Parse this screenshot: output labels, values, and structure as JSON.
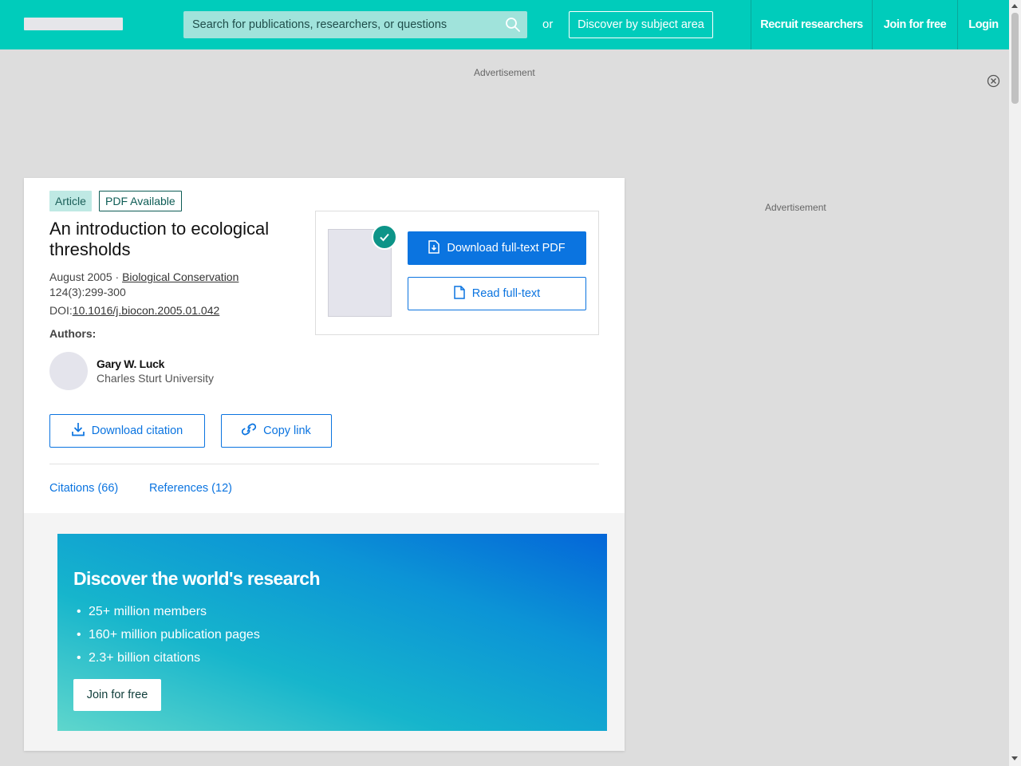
{
  "header": {
    "search_placeholder": "Search for publications, researchers, or questions",
    "or_text": "or",
    "discover_label": "Discover by subject area",
    "nav": {
      "recruit": "Recruit researchers",
      "join": "Join for free",
      "login": "Login"
    }
  },
  "ads": {
    "top_label": "Advertisement",
    "side_label": "Advertisement"
  },
  "article": {
    "badges": {
      "type": "Article",
      "pdf": "PDF Available"
    },
    "title": "An introduction to ecological thresholds",
    "date": "August 2005",
    "separator": " · ",
    "journal": "Biological Conservation",
    "volume_pages": "124(3):299-300",
    "doi_label": "DOI:",
    "doi": "10.1016/j.biocon.2005.01.042",
    "authors_label": "Authors:",
    "author": {
      "name": "Gary W. Luck",
      "institution": "Charles Sturt University"
    },
    "buttons": {
      "download_pdf": "Download full-text PDF",
      "read_fulltext": "Read full-text",
      "download_citation": "Download citation",
      "copy_link": "Copy link"
    },
    "tabs": {
      "citations": "Citations (66)",
      "references": "References (12)"
    }
  },
  "promo": {
    "title": "Discover the world's research",
    "items": [
      "25+ million members",
      "160+ million publication pages",
      "2.3+ billion citations"
    ],
    "join_label": "Join for free"
  },
  "colors": {
    "brand_teal": "#00ccbb",
    "primary_blue": "#0b74e0",
    "check_green": "#0d9488"
  }
}
